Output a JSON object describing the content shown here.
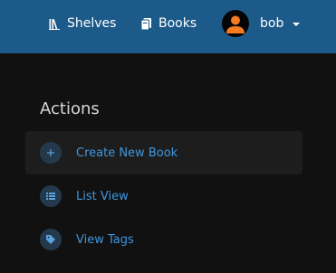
{
  "header": {
    "nav": {
      "shelves_label": "Shelves",
      "books_label": "Books"
    },
    "user": {
      "name": "bob"
    }
  },
  "sidebar": {
    "title": "Actions",
    "actions": [
      {
        "label": "Create New Book",
        "icon": "plus-icon"
      },
      {
        "label": "List View",
        "icon": "list-icon"
      },
      {
        "label": "View Tags",
        "icon": "tag-icon"
      }
    ]
  },
  "colors": {
    "header_bg": "#1c5a8a",
    "page_bg": "#111111",
    "action_text": "#3f97df",
    "avatar_figure": "#f47b20"
  }
}
